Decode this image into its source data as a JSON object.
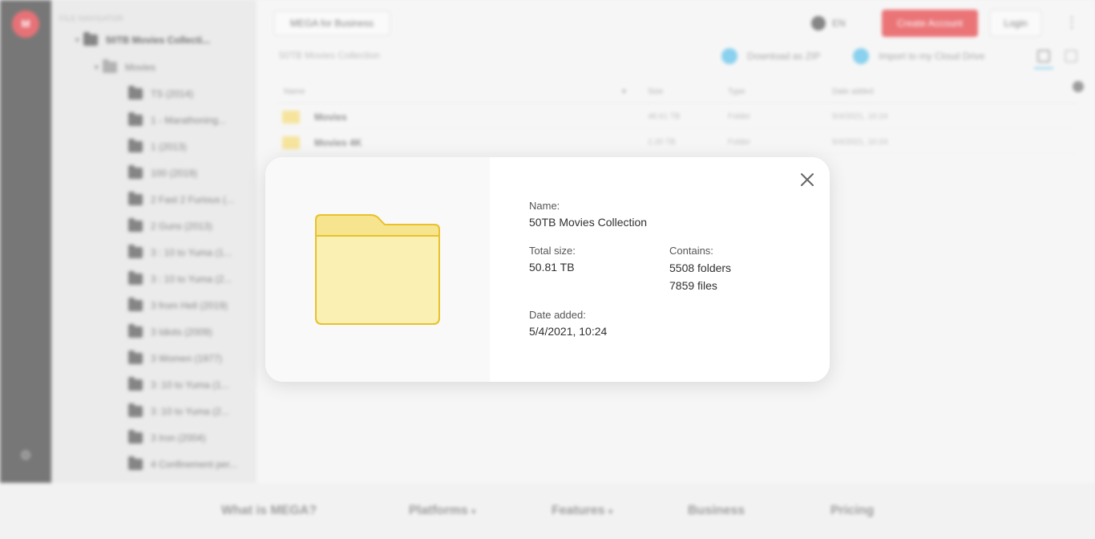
{
  "app": {
    "logo_text": "M",
    "tree": {
      "header": "FILE NAVIGATOR",
      "root": "50TB Movies Collecti...",
      "sub": "Movies",
      "items": [
        "TS (2014)",
        "1 - Marathoning...",
        "1 (2013)",
        "100 (2019)",
        "2 Fast 2 Furious (...",
        "2 Guns (2013)",
        "3 : 10 to Yuma (1...",
        "3 : 10 to Yuma (2...",
        "3 from Hell (2019)",
        "3 Idiots (2009)",
        "3 Women (1977)",
        "3 :10 to Yuma (1...",
        "3 :10 to Yuma (2...",
        "3 Iron (2004)",
        "4 Confinement per..."
      ]
    },
    "toolbar": {
      "business_label": "MEGA for Business",
      "lang_label": "EN",
      "create_label": "Create Account",
      "login_label": "Login"
    },
    "path": "50TB Movies Collection",
    "actions": {
      "download_zip": "Download as ZIP",
      "import_drive": "Import to my Cloud Drive"
    },
    "table": {
      "headers": {
        "name": "Name",
        "size": "Size",
        "type": "Type",
        "date": "Date added"
      },
      "rows": [
        {
          "name": "Movies",
          "size": "48.61 TB",
          "type": "Folder",
          "date": "5/4/2021, 10:24"
        },
        {
          "name": "Movies 4K",
          "size": "2.20 TB",
          "type": "Folder",
          "date": "5/4/2021, 10:24"
        }
      ]
    },
    "footer": {
      "links": [
        "What is MEGA?",
        "Platforms",
        "Features",
        "Business",
        "Pricing"
      ]
    }
  },
  "dialog": {
    "name_label": "Name:",
    "name_value": "50TB Movies Collection",
    "size_label": "Total size:",
    "size_value": "50.81 TB",
    "contains_label": "Contains:",
    "contains_folders": "5508 folders",
    "contains_files": "7859 files",
    "date_label": "Date added:",
    "date_value": "5/4/2021, 10:24"
  },
  "colors": {
    "brand_red": "#d9272e",
    "folder_fill": "#fbf0b3",
    "folder_tab": "#f7e48e",
    "folder_stroke": "#e8c12d",
    "link_blue": "#4bb8e6"
  }
}
